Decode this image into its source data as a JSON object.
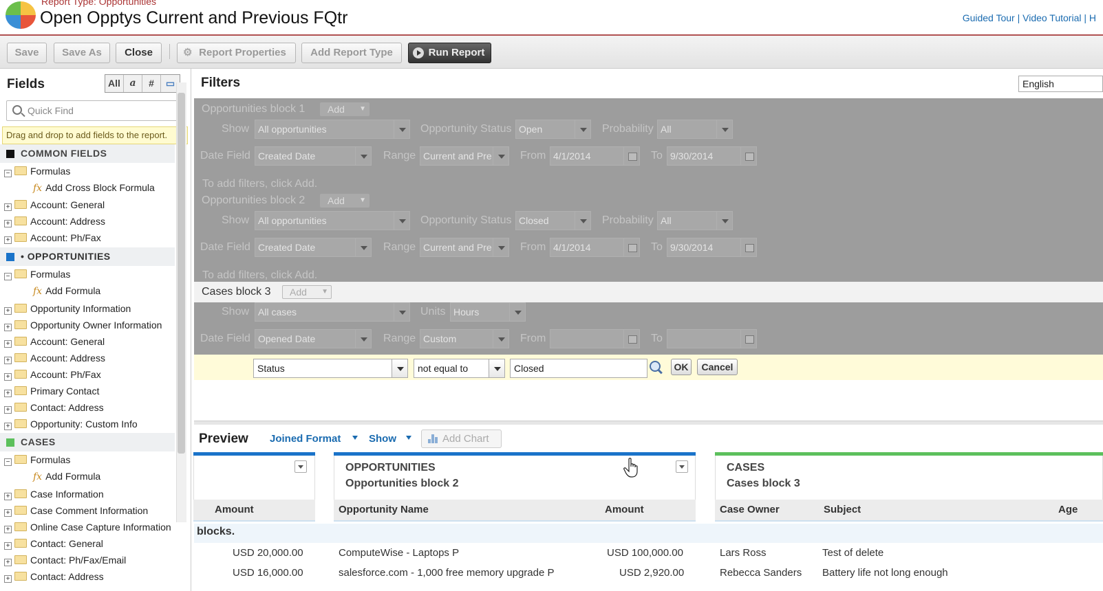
{
  "header": {
    "report_type": "Report Type: Opportunities",
    "title": "Open Opptys Current and Previous FQtr",
    "links": "Guided Tour | Video Tutorial | H"
  },
  "toolbar": {
    "save": "Save",
    "save_as": "Save As",
    "close": "Close",
    "report_properties": "Report Properties",
    "add_report_type": "Add Report Type",
    "run_report": "Run Report"
  },
  "fields_panel": {
    "title": "Fields",
    "toggles": [
      "All",
      "a",
      "#",
      "▭"
    ],
    "quick_find_placeholder": "Quick Find",
    "hint": "Drag and drop to add fields to the report.",
    "sections": [
      {
        "name": "COMMON FIELDS",
        "color": "#111111",
        "items": [
          {
            "label": "Formulas",
            "expander": "⊟",
            "type": "folder"
          },
          {
            "label": "Add Cross Block Formula",
            "type": "formula"
          },
          {
            "label": "Account: General",
            "expander": "⊞",
            "type": "folder"
          },
          {
            "label": "Account: Address",
            "expander": "⊞",
            "type": "folder"
          },
          {
            "label": "Account: Ph/Fax",
            "expander": "⊞",
            "type": "folder"
          }
        ]
      },
      {
        "name": "• OPPORTUNITIES",
        "color": "#1a73c9",
        "items": [
          {
            "label": "Formulas",
            "expander": "⊟",
            "type": "folder"
          },
          {
            "label": "Add Formula",
            "type": "formula"
          },
          {
            "label": "Opportunity Information",
            "expander": "⊞",
            "type": "folder"
          },
          {
            "label": "Opportunity Owner Information",
            "expander": "⊞",
            "type": "folder"
          },
          {
            "label": "Account: General",
            "expander": "⊞",
            "type": "folder"
          },
          {
            "label": "Account: Address",
            "expander": "⊞",
            "type": "folder"
          },
          {
            "label": "Account: Ph/Fax",
            "expander": "⊞",
            "type": "folder"
          },
          {
            "label": "Primary Contact",
            "expander": "⊞",
            "type": "folder"
          },
          {
            "label": "Contact: Address",
            "expander": "⊞",
            "type": "folder"
          },
          {
            "label": "Opportunity: Custom Info",
            "expander": "⊞",
            "type": "folder"
          }
        ]
      },
      {
        "name": "CASES",
        "color": "#5cc05c",
        "items": [
          {
            "label": "Formulas",
            "expander": "⊟",
            "type": "folder"
          },
          {
            "label": "Add Formula",
            "type": "formula"
          },
          {
            "label": "Case Information",
            "expander": "⊞",
            "type": "folder"
          },
          {
            "label": "Case Comment Information",
            "expander": "⊞",
            "type": "folder"
          },
          {
            "label": "Online Case Capture Information",
            "expander": "⊞",
            "type": "folder"
          },
          {
            "label": "Contact: General",
            "expander": "⊞",
            "type": "folder"
          },
          {
            "label": "Contact: Ph/Fax/Email",
            "expander": "⊞",
            "type": "folder"
          },
          {
            "label": "Contact: Address",
            "expander": "⊞",
            "type": "folder"
          }
        ]
      }
    ]
  },
  "filters": {
    "title": "Filters",
    "language": "English",
    "add_label": "Add",
    "labels": {
      "show": "Show",
      "opp_status": "Opportunity Status",
      "probability": "Probability",
      "date_field": "Date Field",
      "range": "Range",
      "from": "From",
      "to": "To",
      "units": "Units"
    },
    "blocks": [
      {
        "name": "Opportunities block 1",
        "show": "All opportunities",
        "status": "Open",
        "probability": "All",
        "date_field": "Created Date",
        "range": "Current and Pre",
        "from": "4/1/2014",
        "to": "9/30/2014",
        "hint": "To add filters, click Add."
      },
      {
        "name": "Opportunities block 2",
        "show": "All opportunities",
        "status": "Closed",
        "probability": "All",
        "date_field": "Created Date",
        "range": "Current and Pre",
        "from": "4/1/2014",
        "to": "9/30/2014",
        "hint": "To add filters, click Add."
      },
      {
        "name": "Cases block 3",
        "show": "All cases",
        "units": "Hours",
        "date_field": "Opened Date",
        "range": "Custom",
        "from": "",
        "to": ""
      }
    ],
    "edit_row": {
      "field": "Status",
      "operator": "not equal to",
      "value": "Closed",
      "ok": "OK",
      "cancel": "Cancel"
    }
  },
  "preview": {
    "title": "Preview",
    "format": "Joined Format",
    "show": "Show",
    "add_chart": "Add Chart",
    "block2_type": "OPPORTUNITIES",
    "block2_name": "Opportunities block 2",
    "block3_type": "CASES",
    "block3_name": "Cases block 3",
    "columns": {
      "amount": "Amount",
      "opp_name": "Opportunity Name",
      "amount2": "Amount",
      "case_owner": "Case Owner",
      "subject": "Subject",
      "age": "Age"
    },
    "blocks_row": "blocks.",
    "rows": [
      {
        "amount": "USD 20,000.00",
        "opp_name": "ComputeWise - Laptops P",
        "amount2": "USD 100,000.00",
        "case_owner": "Lars Ross",
        "subject": "Test of delete"
      },
      {
        "amount": "USD 16,000.00",
        "opp_name": "salesforce.com - 1,000 free memory upgrade P",
        "amount2": "USD 2,920.00",
        "case_owner": "Rebecca Sanders",
        "subject": "Battery life not long enough"
      }
    ]
  },
  "colors": {
    "opportunities_accent": "#1a73c9",
    "cases_accent": "#5cc05c"
  }
}
